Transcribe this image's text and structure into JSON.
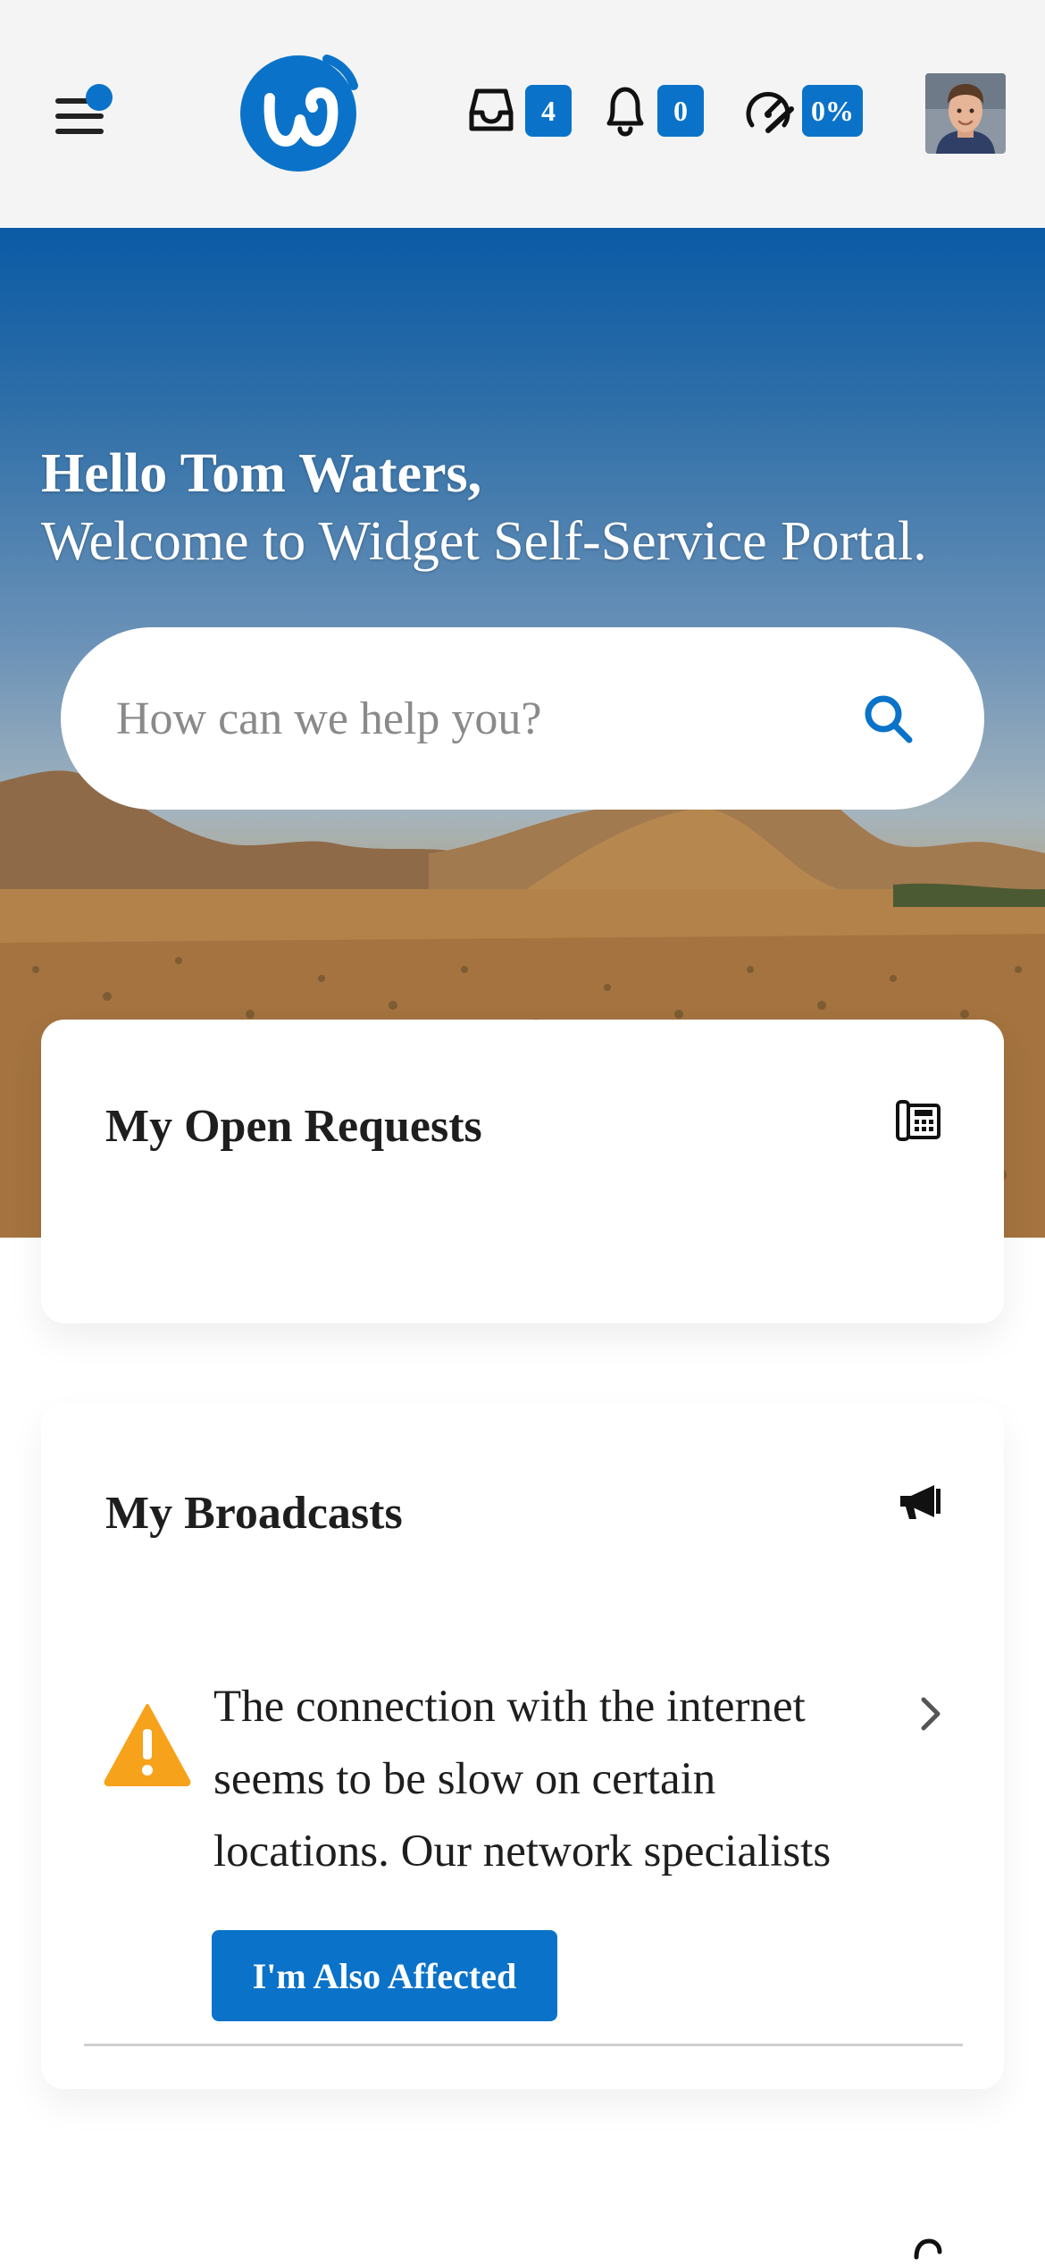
{
  "header": {
    "menu_icon": "hamburger-menu-icon",
    "logo_icon": "widget-logo-icon",
    "inbox": {
      "icon": "inbox-icon",
      "count": "4"
    },
    "notifications": {
      "icon": "bell-icon",
      "count": "0"
    },
    "progress": {
      "icon": "speedometer-icon",
      "value": "0%"
    },
    "avatar_icon": "user-avatar"
  },
  "hero": {
    "greeting": "Hello Tom Waters,",
    "welcome": "Welcome to Widget Self-Service Portal.",
    "search_placeholder": "How can we help you?"
  },
  "open_requests": {
    "title": "My Open Requests",
    "icon": "phone-fax-icon"
  },
  "broadcasts": {
    "title": "My Broadcasts",
    "icon": "megaphone-icon",
    "items": [
      {
        "icon": "warning-icon",
        "text": "The connection with the internet seems to be slow on certain locations. Our network specialists",
        "button": "I'm Also Affected"
      }
    ]
  },
  "colors": {
    "accent": "#0a73c9",
    "warning": "#f7a21b",
    "header_bg": "#f4f4f5"
  }
}
